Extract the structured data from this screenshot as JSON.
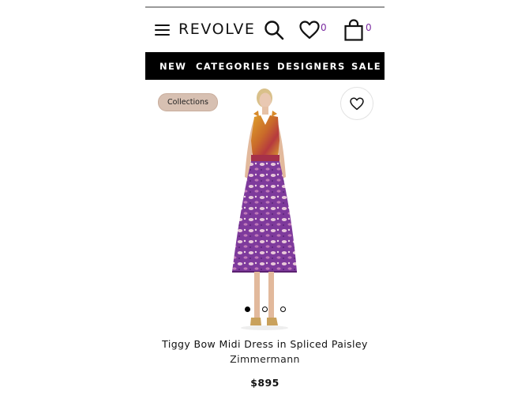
{
  "header": {
    "logo": "REVOLVE",
    "icons": {
      "menu": "hamburger-menu-icon",
      "search": "search-icon",
      "wishlist": "heart-icon",
      "bag": "shopping-bag-icon"
    },
    "wishlist_count": "0",
    "bag_count": "0"
  },
  "nav": {
    "items": [
      "NEW",
      "CATEGORIES",
      "DESIGNERS",
      "SALE"
    ]
  },
  "product": {
    "badge": "Collections",
    "name": "Tiggy Bow Midi Dress in Spliced Paisley",
    "designer": "Zimmermann",
    "price": "$895",
    "image_slides_total": 3,
    "image_slide_active": 1
  },
  "colors": {
    "accent_count": "#7a2aa0",
    "nav_background": "#000000",
    "badge_background": "#d7c0b2"
  }
}
